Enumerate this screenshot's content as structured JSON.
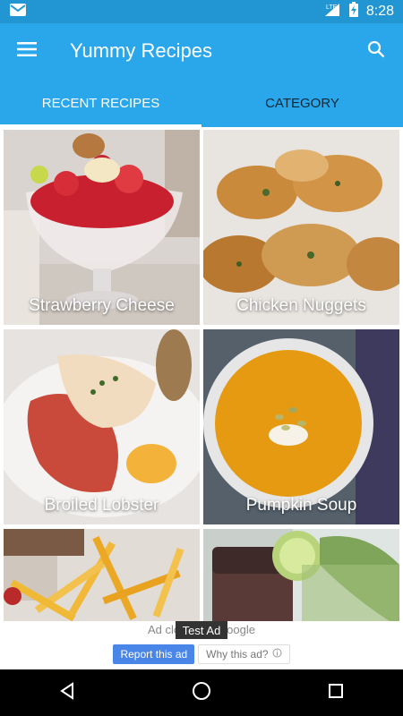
{
  "status_bar": {
    "network": "LTE",
    "time": "8:28",
    "icons": [
      "gmail-icon",
      "signal-icon",
      "battery-charging-icon"
    ]
  },
  "app_bar": {
    "title": "Yummy Recipes",
    "menu_icon": "hamburger-menu-icon",
    "search_icon": "search-icon"
  },
  "tabs": [
    {
      "label": "RECENT RECIPES",
      "active": true
    },
    {
      "label": "CATEGORY",
      "active": false
    }
  ],
  "recipes": [
    {
      "name": "Strawberry Cheese"
    },
    {
      "name": "Chicken Nuggets"
    },
    {
      "name": "Broiled Lobster"
    },
    {
      "name": "Pumpkin Soup"
    },
    {
      "name": ""
    },
    {
      "name": ""
    }
  ],
  "ad": {
    "closed_text": "Ad closed by Google",
    "test_label": "Test Ad",
    "report_label": "Report this ad",
    "why_label": "Why this ad?",
    "info_icon": "info-icon"
  },
  "nav_bar": {
    "back_icon": "back-icon",
    "home_icon": "home-icon",
    "recents_icon": "recents-icon"
  },
  "colors": {
    "primary": "#2aa7eb",
    "status_bar": "#2196d3",
    "ad_button": "#4a86e8"
  }
}
